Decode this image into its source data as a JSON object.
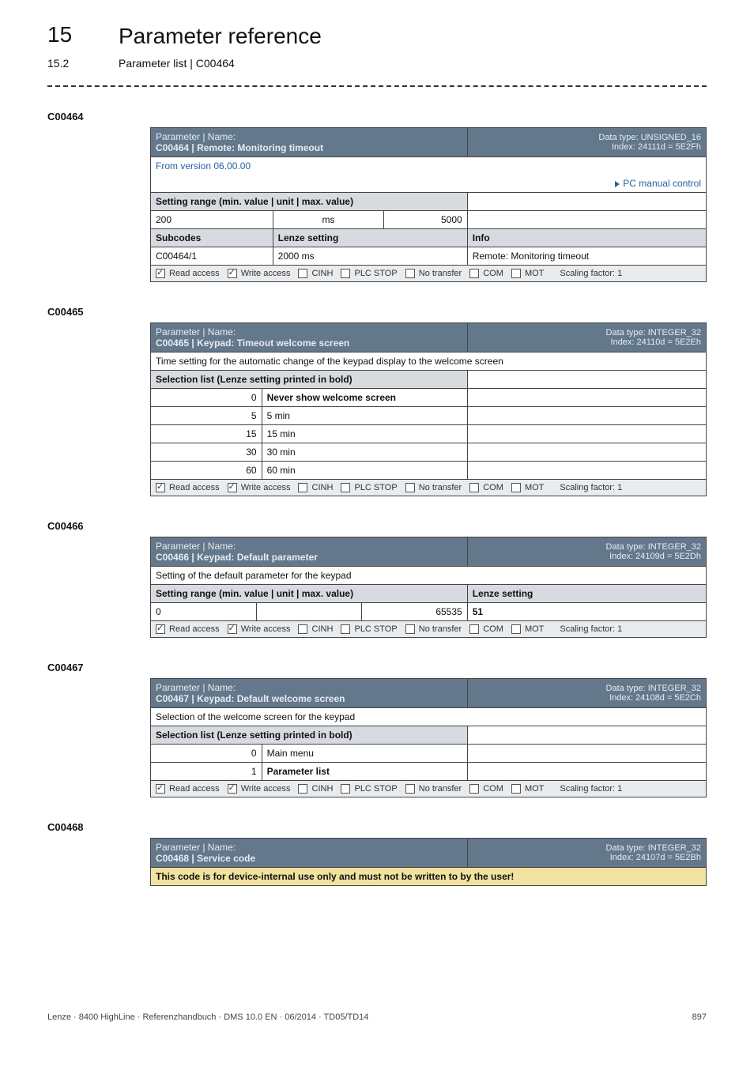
{
  "page": {
    "chapter_number": "15",
    "chapter_title": "Parameter reference",
    "section_number": "15.2",
    "section_title": "Parameter list | C00464",
    "footer_left": "Lenze · 8400 HighLine · Referenzhandbuch · DMS 10.0 EN · 06/2014 · TD05/TD14",
    "footer_right": "897"
  },
  "labels": {
    "parameter_name": "Parameter | Name:",
    "setting_range": "Setting range (min. value | unit | max. value)",
    "selection_list": "Selection list (Lenze setting printed in bold)",
    "subcodes": "Subcodes",
    "lenze_setting": "Lenze setting",
    "info": "Info",
    "scaling": "Scaling factor: 1"
  },
  "access_list": [
    {
      "label": "Read access",
      "checked": true
    },
    {
      "label": "Write access",
      "checked": true
    },
    {
      "label": "CINH",
      "checked": false
    },
    {
      "label": "PLC STOP",
      "checked": false
    },
    {
      "label": "No transfer",
      "checked": false
    },
    {
      "label": "COM",
      "checked": false
    },
    {
      "label": "MOT",
      "checked": false
    }
  ],
  "c00464": {
    "label": "C00464",
    "title_ref": "C00464 |",
    "title": "Remote: Monitoring timeout",
    "type_line": "Data type: UNSIGNED_16\nIndex: 24111d = 5E2Fh",
    "version": "From version 06.00.00",
    "pclink": "PC manual control",
    "range_min": "200",
    "range_unit": "ms",
    "range_max": "5000",
    "sub_code": "C00464/1",
    "sub_value": "2000 ms",
    "sub_info": "Remote: Monitoring timeout"
  },
  "c00465": {
    "label": "C00465",
    "title_ref": "C00465 |",
    "title": "Keypad: Timeout welcome screen",
    "type_line": "Data type: INTEGER_32\nIndex: 24110d = 5E2Eh",
    "desc": "Time setting for the automatic change of the keypad display to the welcome screen",
    "rows": [
      {
        "val": "0",
        "text": "Never show welcome screen",
        "bold": true
      },
      {
        "val": "5",
        "text": "5 min",
        "bold": false
      },
      {
        "val": "15",
        "text": "15 min",
        "bold": false
      },
      {
        "val": "30",
        "text": "30 min",
        "bold": false
      },
      {
        "val": "60",
        "text": "60 min",
        "bold": false
      }
    ]
  },
  "c00466": {
    "label": "C00466",
    "title_ref": "C00466 |",
    "title": "Keypad: Default parameter",
    "type_line": "Data type: INTEGER_32\nIndex: 24109d = 5E2Dh",
    "desc": "Setting of the default parameter for the keypad",
    "range_min": "0",
    "range_max": "65535",
    "lenze_val": "51"
  },
  "c00467": {
    "label": "C00467",
    "title_ref": "C00467 |",
    "title": "Keypad: Default welcome screen",
    "type_line": "Data type: INTEGER_32\nIndex: 24108d = 5E2Ch",
    "desc": "Selection of the welcome screen for the keypad",
    "rows": [
      {
        "val": "0",
        "text": "Main menu",
        "bold": false
      },
      {
        "val": "1",
        "text": "Parameter list",
        "bold": true
      }
    ]
  },
  "c00468": {
    "label": "C00468",
    "title_ref": "C00468 |",
    "title": "Service code",
    "type_line": "Data type: INTEGER_32\nIndex: 24107d = 5E2Bh",
    "warn": "This code is for device-internal use only and must not be written to by the user!"
  }
}
